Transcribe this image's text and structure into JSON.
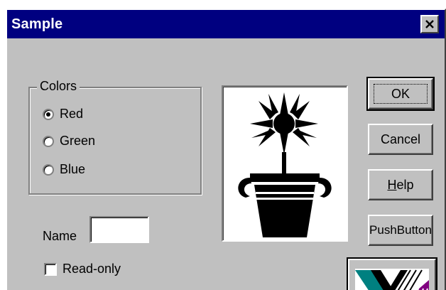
{
  "window": {
    "title": "Sample",
    "close_glyph": "×"
  },
  "colors_group": {
    "label": "Colors",
    "options": [
      {
        "label": "Red",
        "checked": true
      },
      {
        "label": "Green",
        "checked": false
      },
      {
        "label": "Blue",
        "checked": false
      }
    ],
    "selected": "Red"
  },
  "name_field": {
    "label": "Name",
    "value": ""
  },
  "readonly_checkbox": {
    "label": "Read-only",
    "checked": false
  },
  "picture": {
    "icon": "potted-plant-icon"
  },
  "buttons": {
    "ok": "OK",
    "cancel": "Cancel",
    "help_mnemonic": "H",
    "help_rest": "elp",
    "pushbutton": "PushButton"
  },
  "bitmap_button": {
    "icon": "bitmap-pattern-icon",
    "colors": [
      "#008080",
      "#800080",
      "#000000"
    ]
  },
  "theme": {
    "titlebar": "#000080",
    "face": "#c0c0c0"
  }
}
